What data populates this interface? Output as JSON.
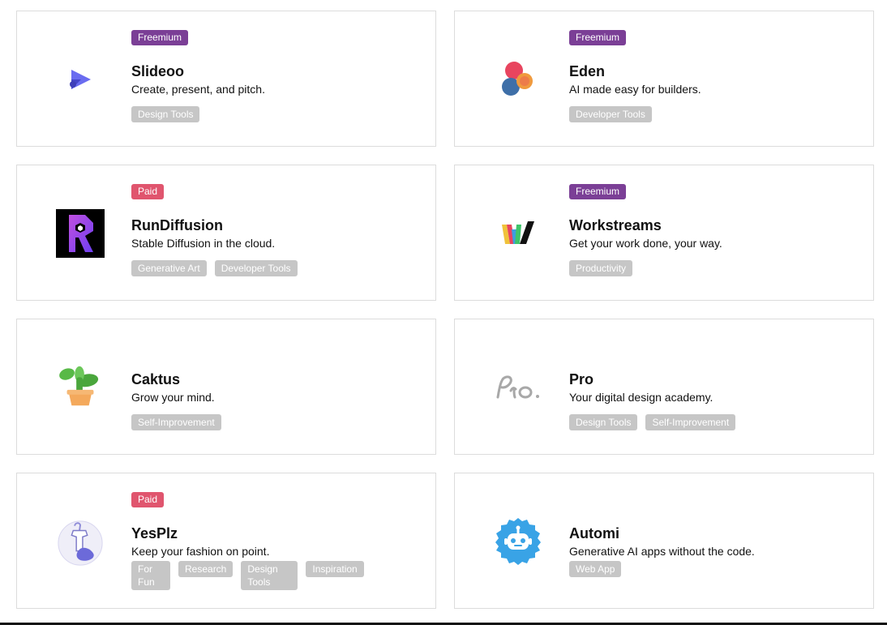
{
  "colors": {
    "freemium": "#7b3f96",
    "paid": "#e0556e",
    "tag_bg": "#c6c6c6",
    "card_border": "#dcdcdc"
  },
  "cards": [
    {
      "name": "Slideoo",
      "description": "Create, present, and pitch.",
      "badge": "Freemium",
      "badge_type": "freemium",
      "logo": "slideoo-play-logo",
      "tags": [
        "Design Tools"
      ]
    },
    {
      "name": "Eden",
      "description": "AI made easy for builders.",
      "badge": "Freemium",
      "badge_type": "freemium",
      "logo": "eden-circles-logo",
      "tags": [
        "Developer Tools"
      ]
    },
    {
      "name": "RunDiffusion",
      "description": "Stable Diffusion in the cloud.",
      "badge": "Paid",
      "badge_type": "paid",
      "logo": "rundiffusion-logo",
      "tags": [
        "Generative Art",
        "Developer Tools"
      ]
    },
    {
      "name": "Workstreams",
      "description": "Get your work done, your way.",
      "badge": "Freemium",
      "badge_type": "freemium",
      "logo": "workstreams-w-logo",
      "tags": [
        "Productivity"
      ]
    },
    {
      "name": "Caktus",
      "description": "Grow your mind.",
      "badge": "",
      "badge_type": "",
      "logo": "cactus-pot-logo",
      "tags": [
        "Self-Improvement"
      ]
    },
    {
      "name": "Pro",
      "description": "Your digital design academy.",
      "badge": "",
      "badge_type": "",
      "logo": "pro-script-logo",
      "tags": [
        "Design Tools",
        "Self-Improvement"
      ]
    },
    {
      "name": "YesPlz",
      "description": "Keep your fashion on point.",
      "badge": "Paid",
      "badge_type": "paid",
      "logo": "yesplz-fashion-logo",
      "tags": [
        "For Fun",
        "Research",
        "Design Tools",
        "Inspiration"
      ]
    },
    {
      "name": "Automi",
      "description": "Generative AI apps without the code.",
      "badge": "",
      "badge_type": "",
      "logo": "automi-robot-logo",
      "tags": [
        "Web App"
      ]
    }
  ]
}
